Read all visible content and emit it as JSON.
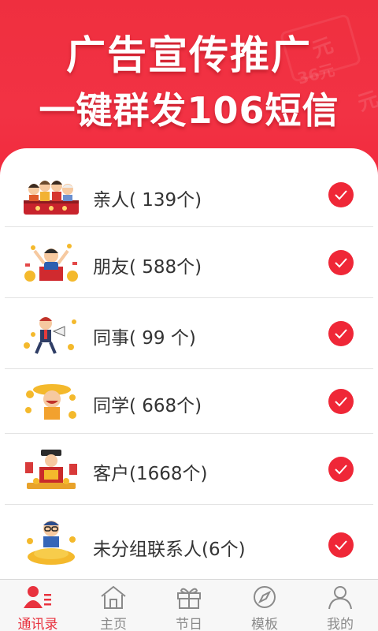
{
  "banner": {
    "line1": "广告宣传推广",
    "line2": "一键群发106短信",
    "deco_text_1": "元",
    "deco_text_2": "36元",
    "deco_text_3": "元"
  },
  "groups": [
    {
      "label": "亲人( 139个)",
      "checked": true,
      "icon": "family-illustration"
    },
    {
      "label": "朋友( 588个)",
      "checked": true,
      "icon": "friend-cheering-illustration"
    },
    {
      "label": "同事(  99 个)",
      "checked": true,
      "icon": "colleague-megaphone-illustration"
    },
    {
      "label": "同学( 668个)",
      "checked": true,
      "icon": "classmate-hat-illustration"
    },
    {
      "label": "客户(1668个)",
      "checked": true,
      "icon": "customer-fortune-god-illustration"
    },
    {
      "label": "未分组联系人(6个)",
      "checked": true,
      "icon": "gold-coins-man-illustration"
    }
  ],
  "tabs": [
    {
      "label": "通讯录",
      "icon": "contacts-icon",
      "active": true
    },
    {
      "label": "主页",
      "icon": "home-icon",
      "active": false
    },
    {
      "label": "节日",
      "icon": "gift-icon",
      "active": false
    },
    {
      "label": "模板",
      "icon": "compass-icon",
      "active": false
    },
    {
      "label": "我的",
      "icon": "user-icon",
      "active": false
    }
  ],
  "colors": {
    "brand_red": "#ef2737",
    "active_tab": "#e8323e",
    "inactive_tab": "#8a8a8a"
  }
}
